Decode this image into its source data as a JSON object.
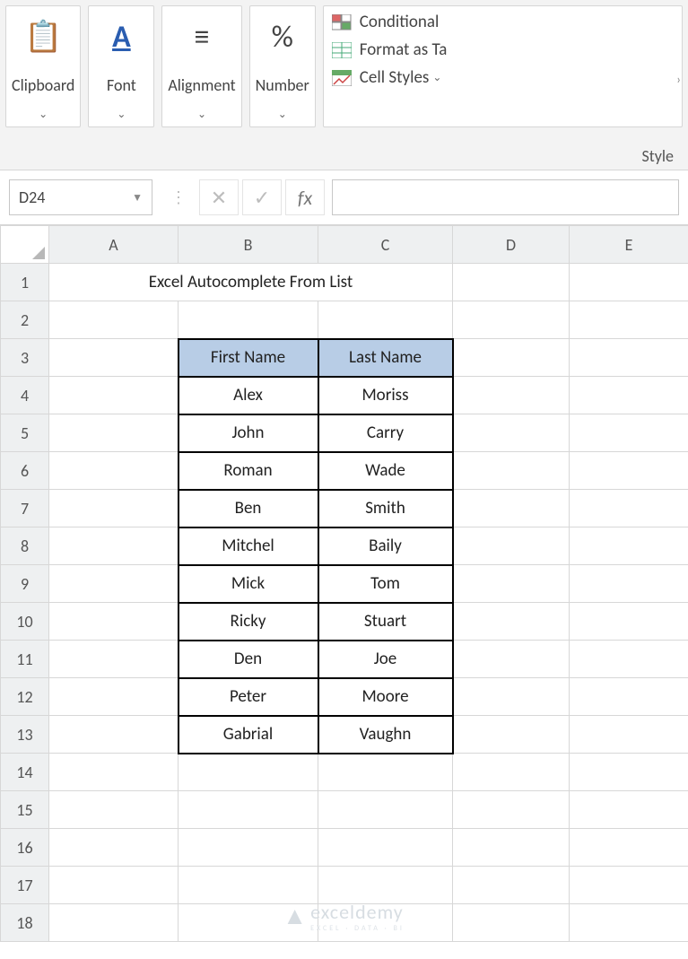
{
  "ribbon": {
    "groups": [
      {
        "name": "clipboard",
        "label": "Clipboard",
        "icon": "📋"
      },
      {
        "name": "font",
        "label": "Font",
        "icon": "A"
      },
      {
        "name": "alignment",
        "label": "Alignment",
        "icon": "≡"
      },
      {
        "name": "number",
        "label": "Number",
        "icon": "%"
      }
    ],
    "styles": {
      "conditional": "Conditional",
      "format_as_table": "Format as Ta",
      "cell_styles": "Cell Styles",
      "footer": "Style"
    }
  },
  "namebox": {
    "value": "D24"
  },
  "formula": {
    "fx": "fx",
    "value": ""
  },
  "columns": [
    "A",
    "B",
    "C",
    "D",
    "E"
  ],
  "rows": [
    "1",
    "2",
    "3",
    "4",
    "5",
    "6",
    "7",
    "8",
    "9",
    "10",
    "11",
    "12",
    "13",
    "14",
    "15",
    "16",
    "17",
    "18"
  ],
  "title": "Excel Autocomplete From List",
  "table": {
    "headers": {
      "first": "First Name",
      "last": "Last Name"
    },
    "rows": [
      {
        "first": "Alex",
        "last": "Moriss"
      },
      {
        "first": "John",
        "last": "Carry"
      },
      {
        "first": "Roman",
        "last": "Wade"
      },
      {
        "first": "Ben",
        "last": "Smith"
      },
      {
        "first": "Mitchel",
        "last": "Baily"
      },
      {
        "first": "Mick",
        "last": "Tom"
      },
      {
        "first": "Ricky",
        "last": "Stuart"
      },
      {
        "first": "Den",
        "last": "Joe"
      },
      {
        "first": "Peter",
        "last": "Moore"
      },
      {
        "first": "Gabrial",
        "last": "Vaughn"
      }
    ]
  },
  "watermark": {
    "brand": "exceldemy",
    "tag": "EXCEL · DATA · BI"
  }
}
